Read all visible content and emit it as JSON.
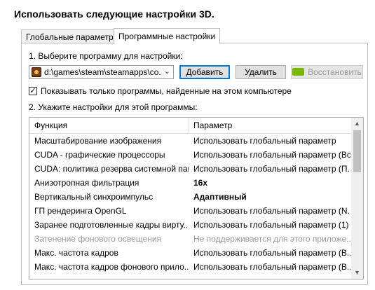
{
  "header": {
    "title": "Использовать следующие настройки 3D."
  },
  "tabs": [
    {
      "label": "Глобальные параметры",
      "active": false
    },
    {
      "label": "Программные настройки",
      "active": true
    }
  ],
  "step1": {
    "label": "1. Выберите программу для настройки:",
    "program_value": "d:\\games\\steam\\steamapps\\co...",
    "program_icon": "game-app-icon",
    "add_button": "Добавить",
    "remove_button": "Удалить",
    "restore_button": "Восстановить",
    "restore_icon": "nvidia-icon"
  },
  "checkbox": {
    "label": "Показывать только программы, найденные на этом компьютере",
    "checked": true
  },
  "step2": {
    "label": "2. Укажите настройки для этой программы:"
  },
  "grid": {
    "headers": [
      "Функция",
      "Параметр"
    ],
    "rows": [
      {
        "feature": "Масштабирование изображения",
        "value": "Использовать глобальный параметр"
      },
      {
        "feature": "CUDA - графические процессоры",
        "value": "Использовать глобальный параметр (Все)"
      },
      {
        "feature": "CUDA: политика резерва системной пам...",
        "value": "Использовать глобальный параметр (П..."
      },
      {
        "feature": "Анизотропная фильтрация",
        "value": "16x"
      },
      {
        "feature": "Вертикальный синхроимпульс",
        "value": "Адаптивный"
      },
      {
        "feature": "ГП рендеринга OpenGL",
        "value": "Использовать глобальный параметр (N..."
      },
      {
        "feature": "Заранее подготовленные кадры вирту...",
        "value": "Использовать глобальный параметр (1)"
      },
      {
        "feature": "Затенение фонового освещения",
        "value": "Не поддерживается для этого приложе..."
      },
      {
        "feature": "Макс. частота кадров",
        "value": "Использовать глобальный параметр (В..."
      },
      {
        "feature": "Макс. частота кадров фонового прило...",
        "value": "Использовать глобальный параметр (В..."
      }
    ]
  },
  "colors": {
    "accent_border": "#0078d7",
    "nvidia_green": "#76b900",
    "disabled_text": "#9a9a9a"
  }
}
